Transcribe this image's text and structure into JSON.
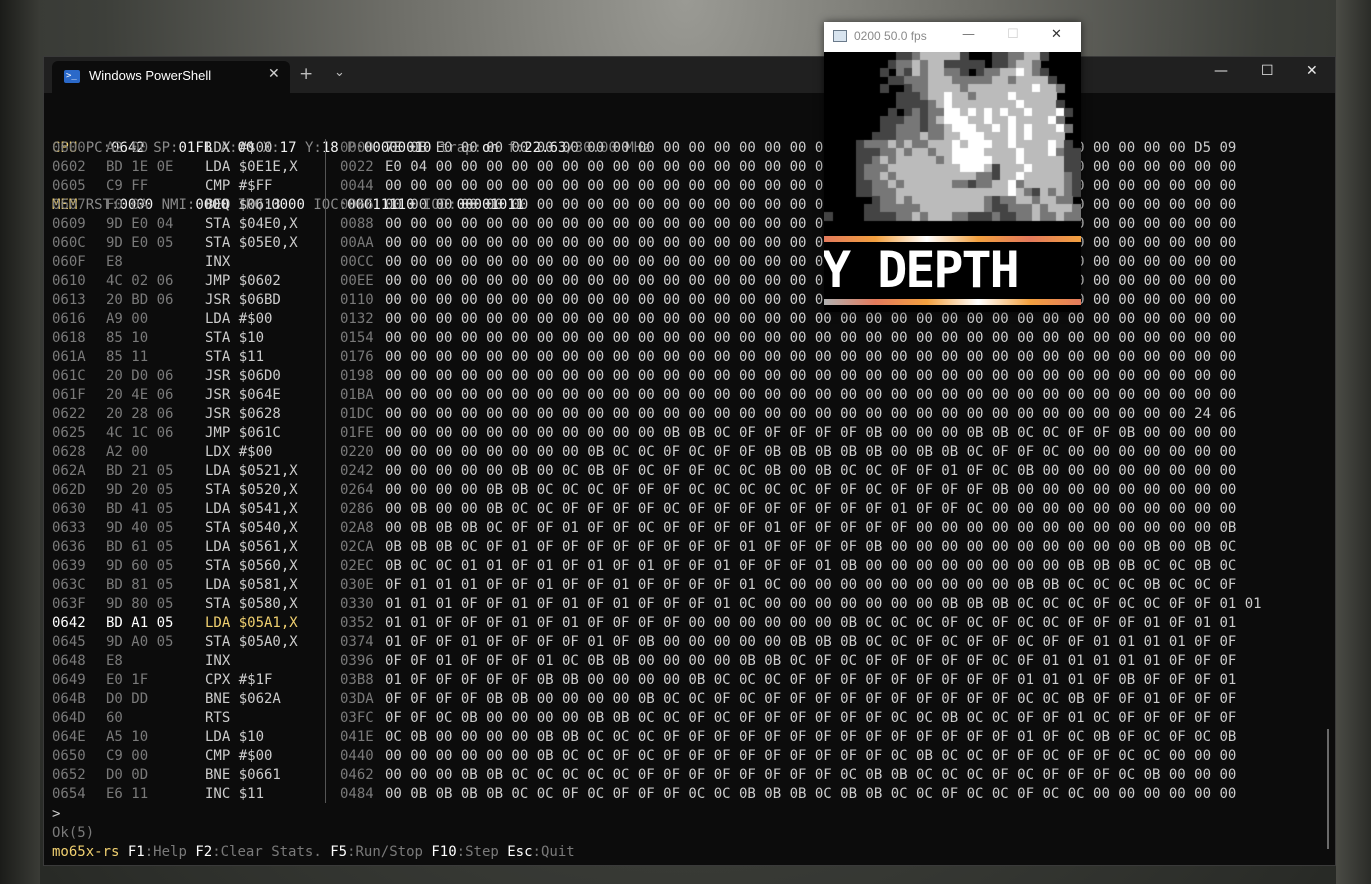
{
  "window": {
    "tab_title": "Windows PowerShell",
    "ps_icon_glyph": ">_",
    "close_tab_glyph": "✕",
    "new_tab_glyph": "+",
    "dropdown_glyph": "⌄",
    "minimize_glyph": "—",
    "maximize_glyph": "☐",
    "close_glyph": "✕"
  },
  "display": {
    "title": "0200 50.0 fps",
    "minimize_glyph": "—",
    "maximize_glyph": "☐",
    "close_glyph": "✕",
    "banner_text": "Y DEPTH"
  },
  "cpu": {
    "label": "CPU",
    "pc_key": "PC:",
    "pc": "0642",
    "sp_key": "SP:",
    "sp": "01FB",
    "a_key": "A:",
    "a": "00",
    "x_key": "X:",
    "x": "17",
    "y_key": "Y:",
    "y": "18",
    "p_key": "P:",
    "p": "00000010",
    "trap_key": "trap:",
    "trap": "on",
    "f_key": "f:",
    "f": "22.63",
    "f_max": "/30.00 MHz"
  },
  "mem": {
    "label": "MEM",
    "rst_key": "RST:",
    "rst": "0000",
    "nmi_key": "NMI:",
    "nmi": "0000",
    "irq_key": "IRQ:",
    "irq": "0000",
    "ioc_key": "IOC:",
    "ioc": "00011110",
    "iod_key": "IOD:",
    "iod": "00001011"
  },
  "disasm": [
    {
      "addr": "0600",
      "bytes": "A2 00",
      "ins": "LDX #$00"
    },
    {
      "addr": "0602",
      "bytes": "BD 1E 0E",
      "ins": "LDA $0E1E,X"
    },
    {
      "addr": "0605",
      "bytes": "C9 FF",
      "ins": "CMP #$FF"
    },
    {
      "addr": "0607",
      "bytes": "F0 0A",
      "ins": "BEQ $0613"
    },
    {
      "addr": "0609",
      "bytes": "9D E0 04",
      "ins": "STA $04E0,X"
    },
    {
      "addr": "060C",
      "bytes": "9D E0 05",
      "ins": "STA $05E0,X"
    },
    {
      "addr": "060F",
      "bytes": "E8",
      "ins": "INX"
    },
    {
      "addr": "0610",
      "bytes": "4C 02 06",
      "ins": "JMP $0602"
    },
    {
      "addr": "0613",
      "bytes": "20 BD 06",
      "ins": "JSR $06BD"
    },
    {
      "addr": "0616",
      "bytes": "A9 00",
      "ins": "LDA #$00"
    },
    {
      "addr": "0618",
      "bytes": "85 10",
      "ins": "STA $10"
    },
    {
      "addr": "061A",
      "bytes": "85 11",
      "ins": "STA $11"
    },
    {
      "addr": "061C",
      "bytes": "20 D0 06",
      "ins": "JSR $06D0"
    },
    {
      "addr": "061F",
      "bytes": "20 4E 06",
      "ins": "JSR $064E"
    },
    {
      "addr": "0622",
      "bytes": "20 28 06",
      "ins": "JSR $0628"
    },
    {
      "addr": "0625",
      "bytes": "4C 1C 06",
      "ins": "JMP $061C"
    },
    {
      "addr": "0628",
      "bytes": "A2 00",
      "ins": "LDX #$00"
    },
    {
      "addr": "062A",
      "bytes": "BD 21 05",
      "ins": "LDA $0521,X"
    },
    {
      "addr": "062D",
      "bytes": "9D 20 05",
      "ins": "STA $0520,X"
    },
    {
      "addr": "0630",
      "bytes": "BD 41 05",
      "ins": "LDA $0541,X"
    },
    {
      "addr": "0633",
      "bytes": "9D 40 05",
      "ins": "STA $0540,X"
    },
    {
      "addr": "0636",
      "bytes": "BD 61 05",
      "ins": "LDA $0561,X"
    },
    {
      "addr": "0639",
      "bytes": "9D 60 05",
      "ins": "STA $0560,X"
    },
    {
      "addr": "063C",
      "bytes": "BD 81 05",
      "ins": "LDA $0581,X"
    },
    {
      "addr": "063F",
      "bytes": "9D 80 05",
      "ins": "STA $0580,X"
    },
    {
      "addr": "0642",
      "bytes": "BD A1 05",
      "ins": "LDA $05A1,X",
      "current": true
    },
    {
      "addr": "0645",
      "bytes": "9D A0 05",
      "ins": "STA $05A0,X"
    },
    {
      "addr": "0648",
      "bytes": "E8",
      "ins": "INX"
    },
    {
      "addr": "0649",
      "bytes": "E0 1F",
      "ins": "CPX #$1F"
    },
    {
      "addr": "064B",
      "bytes": "D0 DD",
      "ins": "BNE $062A"
    },
    {
      "addr": "064D",
      "bytes": "60",
      "ins": "RTS"
    },
    {
      "addr": "064E",
      "bytes": "A5 10",
      "ins": "LDA $10"
    },
    {
      "addr": "0650",
      "bytes": "C9 00",
      "ins": "CMP #$00"
    },
    {
      "addr": "0652",
      "bytes": "D0 0D",
      "ins": "BNE $0661"
    },
    {
      "addr": "0654",
      "bytes": "E6 11",
      "ins": "INC $11"
    }
  ],
  "memory": [
    {
      "addr": "0000",
      "bytes": "7E 0B E0 00 00 00 00 00 00 00 00 00 00 00 00 00 00 00 00 00 00 00 00 00 00 00 00 00 00 00 00 00 D5 09"
    },
    {
      "addr": "0022",
      "bytes": "E0 04 00 00 00 00 00 00 00 00 00 00 00 00 00 00 00 00 00 00 00 00 00 00 00 00 00 00 00 00 00 00 00 00"
    },
    {
      "addr": "0044",
      "bytes": "00 00 00 00 00 00 00 00 00 00 00 00 00 00 00 00 00 00 00 00 00 00 00 00 00 00 00 00 00 00 00 00 00 00"
    },
    {
      "addr": "0066",
      "bytes": "00 00 00 00 00 00 00 00 00 00 00 00 00 00 00 00 00 00 00 00 00 00 00 00 00 00 00 00 00 00 00 00 00 00"
    },
    {
      "addr": "0088",
      "bytes": "00 00 00 00 00 00 00 00 00 00 00 00 00 00 00 00 00 00 00 00 00 00 00 00 00 00 00 00 00 00 00 00 00 00"
    },
    {
      "addr": "00AA",
      "bytes": "00 00 00 00 00 00 00 00 00 00 00 00 00 00 00 00 00 00 00 00 00 00 00 00 00 00 00 00 00 00 00 00 00 00"
    },
    {
      "addr": "00CC",
      "bytes": "00 00 00 00 00 00 00 00 00 00 00 00 00 00 00 00 00 00 00 00 00 00 00 00 00 00 00 00 00 00 00 00 00 00"
    },
    {
      "addr": "00EE",
      "bytes": "00 00 00 00 00 00 00 00 00 00 00 00 00 00 00 00 00 00 00 00 00 00 00 00 00 00 00 00 00 00 00 00 00 00"
    },
    {
      "addr": "0110",
      "bytes": "00 00 00 00 00 00 00 00 00 00 00 00 00 00 00 00 00 00 00 00 00 00 00 00 00 00 00 00 00 00 00 00 00 00"
    },
    {
      "addr": "0132",
      "bytes": "00 00 00 00 00 00 00 00 00 00 00 00 00 00 00 00 00 00 00 00 00 00 00 00 00 00 00 00 00 00 00 00 00 00"
    },
    {
      "addr": "0154",
      "bytes": "00 00 00 00 00 00 00 00 00 00 00 00 00 00 00 00 00 00 00 00 00 00 00 00 00 00 00 00 00 00 00 00 00 00"
    },
    {
      "addr": "0176",
      "bytes": "00 00 00 00 00 00 00 00 00 00 00 00 00 00 00 00 00 00 00 00 00 00 00 00 00 00 00 00 00 00 00 00 00 00"
    },
    {
      "addr": "0198",
      "bytes": "00 00 00 00 00 00 00 00 00 00 00 00 00 00 00 00 00 00 00 00 00 00 00 00 00 00 00 00 00 00 00 00 00 00"
    },
    {
      "addr": "01BA",
      "bytes": "00 00 00 00 00 00 00 00 00 00 00 00 00 00 00 00 00 00 00 00 00 00 00 00 00 00 00 00 00 00 00 00 00 00"
    },
    {
      "addr": "01DC",
      "bytes": "00 00 00 00 00 00 00 00 00 00 00 00 00 00 00 00 00 00 00 00 00 00 00 00 00 00 00 00 00 00 00 00 24 06"
    },
    {
      "addr": "01FE",
      "bytes": "00 00 00 00 00 00 00 00 00 00 00 0B 0B 0C 0F 0F 0F 0F 0F 0B 00 00 00 0B 0B 0C 0C 0F 0F 0B 00 00 00 00"
    },
    {
      "addr": "0220",
      "bytes": "00 00 00 00 00 00 00 00 0B 0C 0C 0F 0C 0F 0F 0B 0B 0B 0B 0B 00 0B 0B 0C 0F 0F 0C 00 00 00 00 00 00 00"
    },
    {
      "addr": "0242",
      "bytes": "00 00 00 00 00 0B 00 0C 0B 0F 0C 0F 0F 0C 0C 0B 00 0B 0C 0C 0F 0F 01 0F 0C 0B 00 00 00 00 00 00 00 00"
    },
    {
      "addr": "0264",
      "bytes": "00 00 00 00 0B 0B 0C 0C 0C 0F 0F 0F 0C 0C 0C 0C 0C 0F 0F 0C 0F 0F 0F 0F 0B 00 00 00 00 00 00 00 00 00"
    },
    {
      "addr": "0286",
      "bytes": "00 0B 00 00 0B 0C 0C 0F 0F 0F 0F 0C 0F 0F 0F 0F 0F 0F 0F 0F 01 0F 0F 0C 00 00 00 00 00 00 00 00 00 00"
    },
    {
      "addr": "02A8",
      "bytes": "00 0B 0B 0B 0C 0F 0F 01 0F 0F 0C 0F 0F 0F 0F 01 0F 0F 0F 0F 0F 00 00 00 00 00 00 00 00 00 00 00 00 0B"
    },
    {
      "addr": "02CA",
      "bytes": "0B 0B 0B 0C 0F 01 0F 0F 0F 0F 0F 0F 0F 0F 01 0F 0F 0F 0F 0B 00 00 00 00 00 00 00 00 00 00 0B 00 0B 0C"
    },
    {
      "addr": "02EC",
      "bytes": "0B 0C 0C 01 01 0F 01 0F 01 0F 01 0F 0F 01 0F 0F 0F 01 0B 00 00 00 00 00 00 00 00 0B 0B 0B 0C 0C 0B 0C"
    },
    {
      "addr": "030E",
      "bytes": "0F 01 01 01 0F 0F 01 0F 0F 01 0F 0F 0F 0F 01 0C 00 00 00 00 00 00 00 00 00 0B 0B 0C 0C 0C 0B 0C 0C 0F"
    },
    {
      "addr": "0330",
      "bytes": "01 01 01 0F 0F 01 0F 01 0F 01 0F 0F 0F 01 0C 00 00 00 00 00 00 00 0B 0B 0B 0C 0C 0C 0F 0C 0C 0F 0F 01 01"
    },
    {
      "addr": "0352",
      "bytes": "01 01 0F 0F 0F 01 0F 01 0F 0F 0F 0F 00 00 00 00 00 00 0B 0C 0C 0C 0F 0C 0F 0C 0C 0F 0F 0F 01 0F 01 01"
    },
    {
      "addr": "0374",
      "bytes": "01 0F 0F 01 0F 0F 0F 0F 01 0F 0B 00 00 00 00 00 0B 0B 0B 0C 0C 0F 0C 0F 0F 0C 0F 0F 01 01 01 01 0F 0F"
    },
    {
      "addr": "0396",
      "bytes": "0F 0F 01 0F 0F 0F 01 0C 0B 0B 00 00 00 00 0B 0B 0C 0F 0C 0F 0F 0F 0F 0F 0C 0F 01 01 01 01 01 0F 0F 0F"
    },
    {
      "addr": "03B8",
      "bytes": "01 0F 0F 0F 0F 0F 0B 0B 00 00 00 00 0B 0C 0C 0C 0F 0F 0F 0F 0F 0F 0F 0F 0F 01 01 01 0F 0B 0F 0F 0F 01"
    },
    {
      "addr": "03DA",
      "bytes": "0F 0F 0F 0F 0B 0B 00 00 00 00 0B 0C 0C 0F 0C 0F 0F 0F 0F 0F 0F 0F 0F 0F 0F 0C 0C 0B 0F 0F 01 0F 0F 0F"
    },
    {
      "addr": "03FC",
      "bytes": "0F 0F 0C 0B 00 00 00 00 0B 0B 0C 0C 0F 0C 0F 0F 0F 0F 0F 0F 0C 0C 0B 0C 0C 0F 0F 01 0C 0F 0F 0F 0F 0F"
    },
    {
      "addr": "041E",
      "bytes": "0C 0B 00 00 00 00 0B 0B 0C 0C 0C 0F 0F 0F 0F 0F 0F 0F 0F 0F 0F 0F 0F 0F 0F 01 0F 0C 0B 0F 0C 0F 0C 0B"
    },
    {
      "addr": "0440",
      "bytes": "00 00 00 00 00 00 0B 0C 0C 0F 0C 0F 0F 0F 0F 0F 0F 0F 0F 0F 0C 0B 0C 0C 0F 0F 0C 0F 0F 0C 0C 00 00 00"
    },
    {
      "addr": "0462",
      "bytes": "00 00 00 0B 0B 0C 0C 0C 0C 0C 0F 0F 0F 0F 0F 0F 0F 0F 0C 0B 0B 0C 0C 0C 0F 0C 0F 0F 0F 0C 0B 00 00 00"
    },
    {
      "addr": "0484",
      "bytes": "00 0B 0B 0B 0B 0C 0C 0F 0C 0F 0F 0F 0C 0C 0B 0B 0B 0C 0B 0B 0C 0C 0F 0C 0C 0F 0C 0C 00 00 00 00 00 00"
    }
  ],
  "console": {
    "prompt": ">",
    "status": "Ok(5)",
    "app_name": "mo65x-rs",
    "shortcuts": [
      {
        "key": "F1",
        "desc": ":Help"
      },
      {
        "key": "F2",
        "desc": ":Clear Stats."
      },
      {
        "key": "F5",
        "desc": ":Run/Stop"
      },
      {
        "key": "F10",
        "desc": ":Step"
      },
      {
        "key": "Esc",
        "desc": ":Quit"
      }
    ]
  },
  "colors": {
    "accent": "#f0d070",
    "terminal_bg": "#0c0c0c",
    "text": "#cccccc",
    "palette_0B": "#444444",
    "palette_0C": "#777777",
    "palette_0F": "#bbbbbb",
    "palette_01": "#ffffff"
  }
}
